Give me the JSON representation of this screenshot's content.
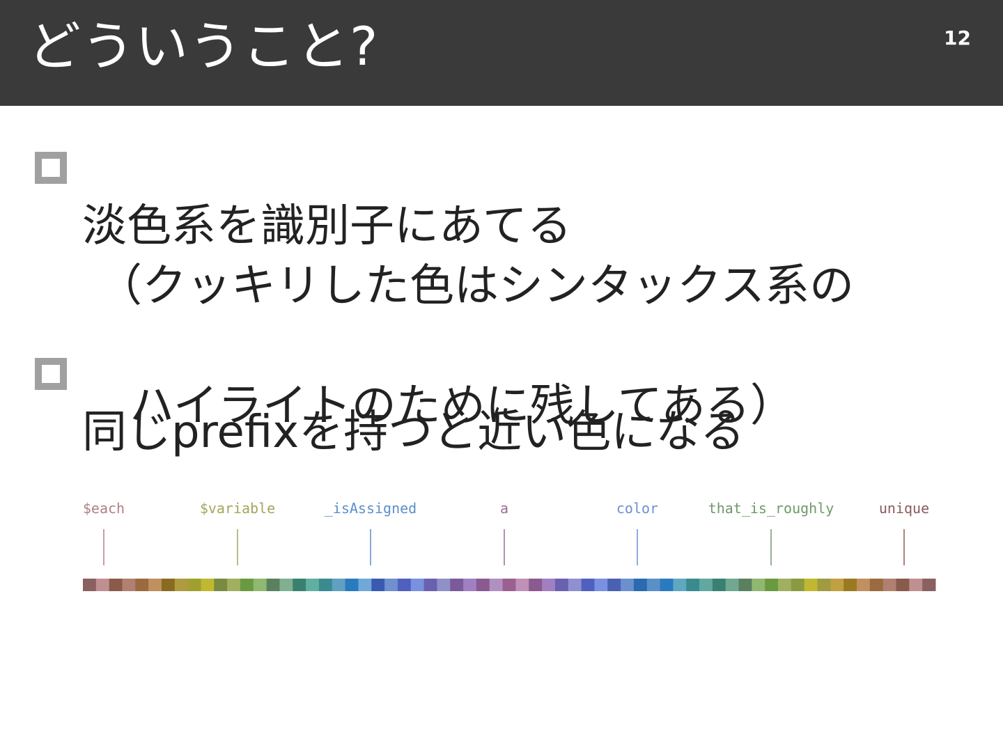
{
  "slide": {
    "title": "どういうこと?",
    "page_number": "12"
  },
  "bullets": [
    {
      "line1": "淡色系を識別子にあてる",
      "line2": "（クッキリした色はシンタックス系の",
      "line3": "ハイライトのために残してある）"
    },
    {
      "line1": "同じprefixを持つと近い色になる"
    }
  ],
  "figure": {
    "identifiers": [
      {
        "text": "$each",
        "color": "#b07f86"
      },
      {
        "text": "$variable",
        "color": "#a3a65a"
      },
      {
        "text": "_isAssigned",
        "color": "#5b8fc8"
      },
      {
        "text": "a",
        "color": "#9c6b9a"
      },
      {
        "text": "color",
        "color": "#6f8fcf"
      },
      {
        "text": "that_is_roughly",
        "color": "#6f9a6a"
      },
      {
        "text": "unique",
        "color": "#8a5a5a"
      }
    ],
    "palette": [
      "#8a6060",
      "#c09090",
      "#8a5a4a",
      "#b08070",
      "#9a6a40",
      "#c09060",
      "#8a6a20",
      "#b09a40",
      "#a0a030",
      "#c0b830",
      "#7a8a40",
      "#a0b060",
      "#6a9a40",
      "#90b870",
      "#5a8060",
      "#80b090",
      "#3a8070",
      "#60b0a0",
      "#3a8a90",
      "#60a0c0",
      "#2a7ac0",
      "#70a8d8",
      "#3a5ab0",
      "#7090d0",
      "#5060c0",
      "#7a90e0",
      "#6a60b0",
      "#9090c8",
      "#7a5a9a",
      "#a080c0",
      "#8a5a90",
      "#b090c0",
      "#9a6090",
      "#c090b8",
      "#8a5a90",
      "#a080c0",
      "#6a60b0",
      "#9090d0",
      "#5060c0",
      "#7a90e0",
      "#4a60b0",
      "#6a90d0",
      "#2a6ab0",
      "#5a90c8",
      "#2a7ac0",
      "#60a8c0",
      "#3a8a90",
      "#60a8a0",
      "#3a8070",
      "#70a890",
      "#5a8060",
      "#90b870",
      "#6a9a40",
      "#a0b060",
      "#8a9a40",
      "#c0b830",
      "#a09a40",
      "#c0a040",
      "#9a7a20",
      "#c09060",
      "#9a6a40",
      "#b08070",
      "#8a5a4a",
      "#c09090",
      "#8a6060"
    ]
  }
}
